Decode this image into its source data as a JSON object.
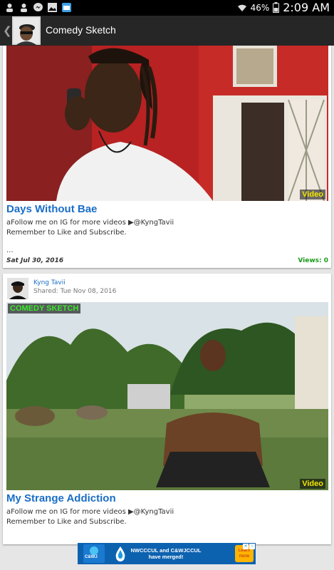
{
  "status_bar": {
    "battery_percent": "46%",
    "time": "2:09 AM",
    "notification_icons": [
      "person-icon",
      "person-icon",
      "messenger-icon",
      "photo-icon",
      "app-icon"
    ],
    "status_icons": [
      "wifi-icon",
      "battery-icon"
    ]
  },
  "app_bar": {
    "title": "Comedy Sketch",
    "back_icon": "chevron-left-icon"
  },
  "posts": [
    {
      "badge": "Video",
      "title": "Days Without Bae",
      "description_line1": "aFollow me on IG for more videos ▶@KyngTavii",
      "description_line2": "Remember to Like and Subscribe.",
      "ellipsis": "...",
      "date": "Sat Jul 30, 2016",
      "views": "Views: 0"
    },
    {
      "sharer_name": "Kyng Tavii",
      "shared_date": "Shared: Tue Nov 08, 2016",
      "overlay_label": "COMEDY SKETCH",
      "badge": "Video",
      "title": "My Strange Addiction",
      "description_line1": "aFollow me on IG for more videos ▶@KyngTavii",
      "description_line2": "Remember to Like and Subscribe."
    }
  ],
  "ad": {
    "logo_label": "C&WJ",
    "text": "NWCCCUL and C&WJCCUL have merged!",
    "button": "Learn more",
    "info_icon": "info-icon",
    "close_icon": "close-icon"
  },
  "colors": {
    "title_blue": "#1a6ec8",
    "views_green": "#1a9a1a",
    "badge_yellow": "#f2e400",
    "overlay_green": "#38e82c",
    "app_bar": "#262626",
    "ad_blue": "#0d62b0"
  }
}
